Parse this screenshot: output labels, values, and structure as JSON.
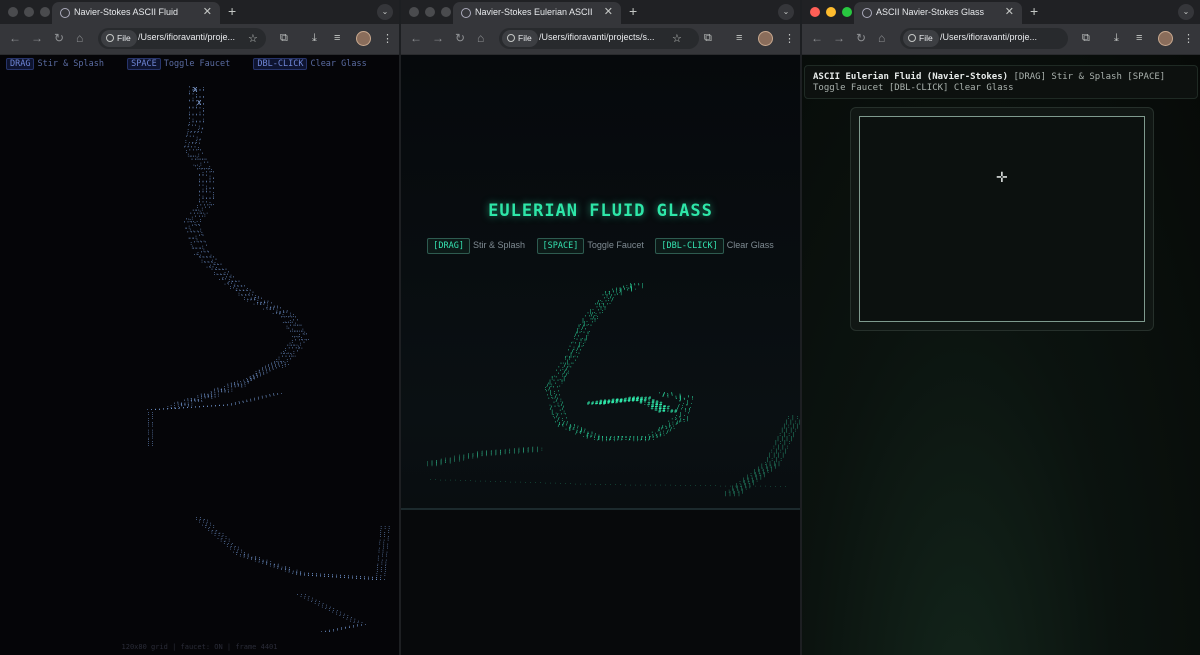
{
  "windows": [
    {
      "tab_title": "Navier-Stokes ASCII Fluid",
      "url": "/Users/ifioravanti/proje...",
      "file_chip": "File",
      "controls": [
        {
          "key": "DRAG",
          "desc": "Stir & Splash"
        },
        {
          "key": "SPACE",
          "desc": "Toggle Faucet"
        },
        {
          "key": "DBL-CLICK",
          "desc": "Clear Glass"
        }
      ],
      "footer": "120x80 grid | faucet: ON | frame 4401"
    },
    {
      "tab_title": "Navier-Stokes Eulerian ASCII",
      "url": "/Users/ifioravanti/projects/s...",
      "file_chip": "File",
      "heading": "EULERIAN FLUID GLASS",
      "controls": [
        {
          "key": "[DRAG]",
          "desc": "Stir & Splash"
        },
        {
          "key": "[SPACE]",
          "desc": "Toggle Faucet"
        },
        {
          "key": "[DBL-CLICK]",
          "desc": "Clear Glass"
        }
      ]
    },
    {
      "tab_title": "ASCII Navier-Stokes Glass",
      "url": "/Users/ifioravanti/proje...",
      "file_chip": "File",
      "hud_title": "ASCII Eulerian Fluid (Navier-Stokes)",
      "hud_text": "[DRAG] Stir & Splash [SPACE] Toggle Faucet [DBL-CLICK] Clear Glass"
    }
  ],
  "icons": {
    "back": "arrow-left-icon",
    "forward": "arrow-right-icon",
    "reload": "reload-icon",
    "home": "home-icon",
    "star": "star-icon",
    "extensions": "puzzle-icon",
    "download": "download-icon",
    "media": "media-control-icon",
    "profile": "avatar",
    "menu": "kebab-menu-icon",
    "close_tab": "close-icon",
    "new_tab": "plus-icon",
    "crosshair": "crosshair-cursor-icon"
  },
  "colors": {
    "fluid_blue": "#7fa8e8",
    "fluid_green": "#2ee6a8",
    "accent_green": "#35e3b1"
  }
}
